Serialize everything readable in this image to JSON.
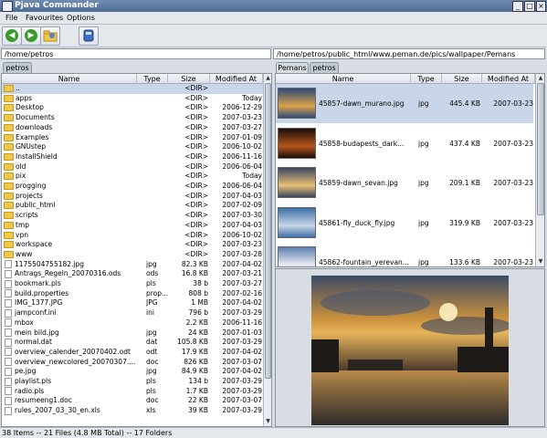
{
  "window": {
    "title": "Pjava Commander",
    "min_glyph": "_",
    "max_glyph": "□",
    "close_glyph": "×"
  },
  "menu": {
    "file": "File",
    "favourites": "Favourites",
    "options": "Options"
  },
  "toolbar": {
    "back_icon": "back-arrow-icon",
    "back_glyph": "◀",
    "forward_icon": "forward-arrow-icon",
    "forward_glyph": "▶",
    "favorites_icon": "favorites-folder-icon",
    "drive_icon": "drive-icon"
  },
  "left": {
    "path": "/home/petros",
    "tabs": [
      "petros"
    ],
    "columns": [
      "Name",
      "Type",
      "Size",
      "Modified At"
    ],
    "rows": [
      {
        "name": "..",
        "type": "",
        "size": "<DIR>",
        "modified": "",
        "kind": "folder",
        "selected": true
      },
      {
        "name": "apps",
        "type": "",
        "size": "<DIR>",
        "modified": "Today",
        "kind": "folder"
      },
      {
        "name": "Desktop",
        "type": "",
        "size": "<DIR>",
        "modified": "2006-12-29",
        "kind": "folder"
      },
      {
        "name": "Documents",
        "type": "",
        "size": "<DIR>",
        "modified": "2007-03-23",
        "kind": "folder"
      },
      {
        "name": "downloads",
        "type": "",
        "size": "<DIR>",
        "modified": "2007-03-27",
        "kind": "folder"
      },
      {
        "name": "Examples",
        "type": "",
        "size": "<DIR>",
        "modified": "2007-01-09",
        "kind": "folder"
      },
      {
        "name": "GNUstep",
        "type": "",
        "size": "<DIR>",
        "modified": "2006-10-02",
        "kind": "folder"
      },
      {
        "name": "InstallShield",
        "type": "",
        "size": "<DIR>",
        "modified": "2006-11-16",
        "kind": "folder"
      },
      {
        "name": "old",
        "type": "",
        "size": "<DIR>",
        "modified": "2006-06-04",
        "kind": "folder"
      },
      {
        "name": "pix",
        "type": "",
        "size": "<DIR>",
        "modified": "Today",
        "kind": "folder"
      },
      {
        "name": "progging",
        "type": "",
        "size": "<DIR>",
        "modified": "2006-06-04",
        "kind": "folder"
      },
      {
        "name": "projects",
        "type": "",
        "size": "<DIR>",
        "modified": "2007-04-03",
        "kind": "folder"
      },
      {
        "name": "public_html",
        "type": "",
        "size": "<DIR>",
        "modified": "2007-02-09",
        "kind": "folder"
      },
      {
        "name": "scripts",
        "type": "",
        "size": "<DIR>",
        "modified": "2007-03-30",
        "kind": "folder"
      },
      {
        "name": "tmp",
        "type": "",
        "size": "<DIR>",
        "modified": "2007-04-03",
        "kind": "folder"
      },
      {
        "name": "vpn",
        "type": "",
        "size": "<DIR>",
        "modified": "2006-10-02",
        "kind": "folder"
      },
      {
        "name": "workspace",
        "type": "",
        "size": "<DIR>",
        "modified": "2007-03-23",
        "kind": "folder"
      },
      {
        "name": "www",
        "type": "",
        "size": "<DIR>",
        "modified": "2007-03-28",
        "kind": "folder"
      },
      {
        "name": "1175504755182.jpg",
        "type": "jpg",
        "size": "82.3 KB",
        "modified": "2007-04-02",
        "kind": "file"
      },
      {
        "name": "Antrags_Regeln_20070316.ods",
        "type": "ods",
        "size": "16.8 KB",
        "modified": "2007-03-21",
        "kind": "file"
      },
      {
        "name": "bookmark.pls",
        "type": "pls",
        "size": "38 b",
        "modified": "2007-03-27",
        "kind": "file"
      },
      {
        "name": "build.properties",
        "type": "prop...",
        "size": "808 b",
        "modified": "2007-02-16",
        "kind": "file"
      },
      {
        "name": "IMG_1377.JPG",
        "type": "JPG",
        "size": "1 MB",
        "modified": "2007-04-02",
        "kind": "file"
      },
      {
        "name": "jampconf.ini",
        "type": "ini",
        "size": "796 b",
        "modified": "2007-03-29",
        "kind": "file"
      },
      {
        "name": "mbox",
        "type": "",
        "size": "2.2 KB",
        "modified": "2006-11-16",
        "kind": "file"
      },
      {
        "name": "mein bild.jpg",
        "type": "jpg",
        "size": "24 KB",
        "modified": "2007-01-03",
        "kind": "file"
      },
      {
        "name": "normal.dat",
        "type": "dat",
        "size": "105.8 KB",
        "modified": "2007-03-29",
        "kind": "file"
      },
      {
        "name": "overview_calender_20070402.odt",
        "type": "odt",
        "size": "17.9 KB",
        "modified": "2007-04-02",
        "kind": "file"
      },
      {
        "name": "overview_newcolored_20070307....",
        "type": "doc",
        "size": "826 KB",
        "modified": "2007-03-07",
        "kind": "file"
      },
      {
        "name": "pe.jpg",
        "type": "jpg",
        "size": "84.9 KB",
        "modified": "2007-04-02",
        "kind": "file"
      },
      {
        "name": "playlist.pls",
        "type": "pls",
        "size": "134 b",
        "modified": "2007-03-29",
        "kind": "file"
      },
      {
        "name": "radio.pls",
        "type": "pls",
        "size": "1.7 KB",
        "modified": "2007-03-29",
        "kind": "file"
      },
      {
        "name": "resumeeng1.doc",
        "type": "doc",
        "size": "22 KB",
        "modified": "2007-03-07",
        "kind": "file"
      },
      {
        "name": "rules_2007_03_30_en.xls",
        "type": "xls",
        "size": "39 KB",
        "modified": "2007-03-29",
        "kind": "file"
      }
    ]
  },
  "right": {
    "path": "/home/petros/public_html/www.peman.de/pics/wallpaper/Pemans",
    "tabs": [
      "Pemans",
      "petros"
    ],
    "columns": [
      "Name",
      "Type",
      "Size",
      "Modified At"
    ],
    "rows": [
      {
        "name": "45857-dawn_murano.jpg",
        "type": "jpg",
        "size": "445.4 KB",
        "modified": "2007-03-23",
        "selected": true,
        "c1": "#2e4a7a",
        "c2": "#d9a24b"
      },
      {
        "name": "45858-budapests_dark...",
        "type": "jpg",
        "size": "437.4 KB",
        "modified": "2007-03-23",
        "c1": "#1a0d08",
        "c2": "#b6561c"
      },
      {
        "name": "45859-dawn_sevan.jpg",
        "type": "jpg",
        "size": "209.1 KB",
        "modified": "2007-03-23",
        "c1": "#3a4660",
        "c2": "#e9c075"
      },
      {
        "name": "45861-fly_duck_fly.jpg",
        "type": "jpg",
        "size": "319.9 KB",
        "modified": "2007-03-23",
        "c1": "#3d6fa8",
        "c2": "#c7d7e6"
      },
      {
        "name": "45862-fountain_yerevan...",
        "type": "jpg",
        "size": "133.6 KB",
        "modified": "2007-03-23",
        "c1": "#5d7fb3",
        "c2": "#e7ebf3"
      }
    ]
  },
  "status": "38 Items -- 21 Files (4.8 MB Total) -- 17 Folders"
}
